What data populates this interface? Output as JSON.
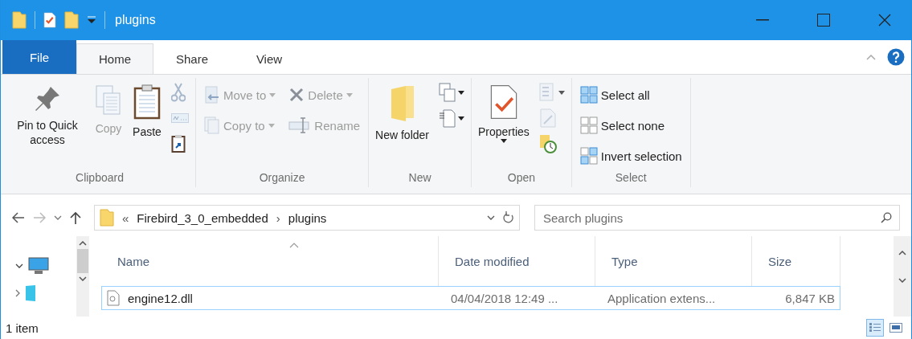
{
  "window": {
    "title": "plugins"
  },
  "tabs": [
    {
      "label": "File",
      "kind": "file",
      "selected": false
    },
    {
      "label": "Home",
      "kind": "tab",
      "selected": true
    },
    {
      "label": "Share",
      "kind": "tab",
      "selected": false
    },
    {
      "label": "View",
      "kind": "tab",
      "selected": false
    }
  ],
  "ribbon": {
    "groups": [
      {
        "label": "Clipboard",
        "columns": [
          [
            {
              "kind": "large",
              "label": "Pin to Quick access",
              "disabled": false
            }
          ],
          [
            {
              "kind": "large",
              "label": "Copy",
              "disabled": true
            }
          ],
          [
            {
              "kind": "large",
              "label": "Paste",
              "disabled": false
            }
          ],
          [
            {
              "kind": "icon",
              "disabled": true
            },
            {
              "kind": "icon",
              "disabled": true
            },
            {
              "kind": "icon",
              "disabled": false
            }
          ]
        ]
      },
      {
        "label": "Organize",
        "columns": [
          [
            {
              "kind": "small",
              "label": "Move to",
              "disabled": true,
              "dropdown": true
            },
            {
              "kind": "small",
              "label": "Copy to",
              "disabled": true,
              "dropdown": true
            }
          ],
          [
            {
              "kind": "small",
              "label": "Delete",
              "disabled": true,
              "dropdown": true
            },
            {
              "kind": "small",
              "label": "Rename",
              "disabled": true,
              "dropdown": false
            }
          ]
        ]
      },
      {
        "label": "New",
        "columns": [
          [
            {
              "kind": "large",
              "label": "New folder",
              "disabled": false
            }
          ],
          [
            {
              "kind": "icon",
              "disabled": false,
              "dropdown": true
            },
            {
              "kind": "icon",
              "disabled": false,
              "dropdown": true
            }
          ]
        ]
      },
      {
        "label": "Open",
        "columns": [
          [
            {
              "kind": "large",
              "label": "Properties",
              "disabled": false,
              "dropdown": true
            }
          ],
          [
            {
              "kind": "icon",
              "disabled": true,
              "dropdown": true
            },
            {
              "kind": "icon",
              "disabled": true
            },
            {
              "kind": "icon",
              "disabled": false
            }
          ]
        ]
      },
      {
        "label": "Select",
        "columns": [
          [
            {
              "kind": "small",
              "label": "Select all",
              "disabled": false
            },
            {
              "kind": "small",
              "label": "Select none",
              "disabled": false
            },
            {
              "kind": "small",
              "label": "Invert selection",
              "disabled": false
            }
          ]
        ]
      }
    ]
  },
  "address": {
    "overflow": "«",
    "segments": [
      "Firebird_3_0_embedded",
      "plugins"
    ],
    "separator": "›"
  },
  "search": {
    "placeholder": "Search plugins"
  },
  "file_list": {
    "columns": [
      "Name",
      "Date modified",
      "Type",
      "Size"
    ],
    "rows": [
      {
        "name": "engine12.dll",
        "date_modified": "04/04/2018 12:49 ...",
        "type": "Application extens...",
        "size": "6,847 KB",
        "focused": true
      }
    ]
  },
  "status_bar": {
    "text": "1 item",
    "views": [
      {
        "kind": "details",
        "selected": true
      },
      {
        "kind": "tiles",
        "selected": false
      }
    ]
  }
}
